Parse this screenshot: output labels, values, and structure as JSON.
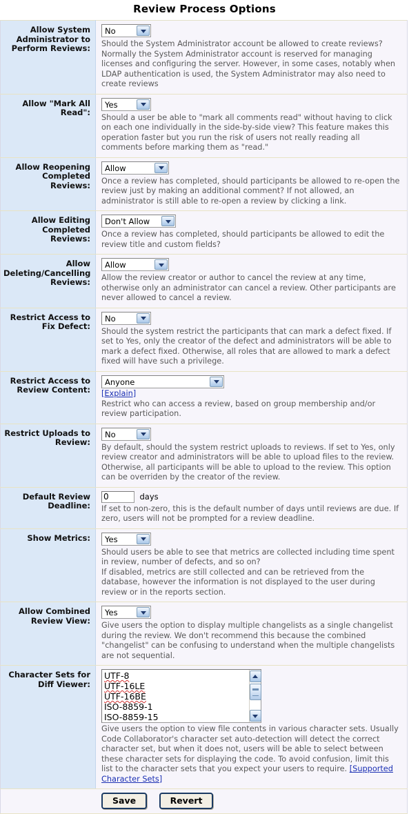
{
  "header": {
    "title": "Review Process Options"
  },
  "options": [
    {
      "label": "Allow System Administrator to Perform Reviews:",
      "control": "select",
      "value": "No",
      "width_class": "w-sel-narrow",
      "desc": [
        "Should the System Administrator account be allowed to create reviews? Normally the System Administrator account is reserved for managing licenses and configuring the server. However, in some cases, notably when LDAP authentication is used, the System Administrator may also need to create reviews"
      ]
    },
    {
      "label": "Allow \"Mark All Read\":",
      "control": "select",
      "value": "Yes",
      "width_class": "w-sel-narrow",
      "desc": [
        "Should a user be able to \"mark all comments read\" without having to click on each one individually in the side-by-side view? This feature makes this operation faster but you run the risk of users not really reading all comments before marking them as \"read.\""
      ]
    },
    {
      "label": "Allow Reopening Completed Reviews:",
      "control": "select",
      "value": "Allow",
      "width_class": "w-sel-allow",
      "desc": [
        "Once a review has completed, should participants be allowed to re-open the review just by making an additional comment? If not allowed, an administrator is still able to re-open a review by clicking a link."
      ]
    },
    {
      "label": "Allow Editing Completed Reviews:",
      "control": "select",
      "value": "Don't Allow",
      "width_class": "w-sel-dontallow",
      "desc": [
        "Once a review has completed, should participants be allowed to edit the review title and custom fields?"
      ]
    },
    {
      "label": "Allow Deleting/Cancelling Reviews:",
      "control": "select",
      "value": "Allow",
      "width_class": "w-sel-allow",
      "desc": [
        "Allow the review creator or author to cancel the review at any time, otherwise only an administrator can cancel a review. Other participants are never allowed to cancel a review."
      ]
    },
    {
      "label": "Restrict Access to Fix Defect:",
      "control": "select",
      "value": "No",
      "width_class": "w-sel-narrow",
      "desc": [
        "Should the system restrict the participants that can mark a defect fixed. If set to Yes, only the creator of the defect and administrators will be able to mark a defect fixed. Otherwise, all roles that are allowed to mark a defect fixed will have such a privilege."
      ]
    },
    {
      "label": "Restrict Access to Review Content:",
      "control": "select",
      "value": "Anyone",
      "width_class": "w-sel-wide",
      "link": "[Explain]",
      "desc": [
        "Restrict who can access a review, based on group membership and/or review participation."
      ]
    },
    {
      "label": "Restrict Uploads to Review:",
      "control": "select",
      "value": "No",
      "width_class": "w-sel-narrow",
      "desc": [
        "By default, should the system restrict uploads to reviews. If set to Yes, only review creator and administrators will be able to upload files to the review. Otherwise, all participants will be able to upload to the review. This option can be overriden by the creator of the review."
      ]
    },
    {
      "label": "Default Review Deadline:",
      "control": "text",
      "value": "0",
      "unit": "days",
      "desc": [
        "If set to non-zero, this is the default number of days until reviews are due. If zero, users will not be prompted for a review deadline."
      ]
    },
    {
      "label": "Show Metrics:",
      "control": "select",
      "value": "Yes",
      "width_class": "w-sel-narrow",
      "desc": [
        "Should users be able to see that metrics are collected including time spent in review, number of defects, and so on?",
        "If disabled, metrics are still collected and can be retrieved from the database, however the information is not displayed to the user during review or in the reports section."
      ]
    },
    {
      "label": "Allow Combined Review View:",
      "control": "select",
      "value": "Yes",
      "width_class": "w-sel-narrow",
      "desc": [
        "Give users the option to display multiple changelists as a single changelist during the review. We don't recommend this because the combined \"changelist\" can be confusing to understand when the multiple changelists are not sequential."
      ]
    },
    {
      "label": "Character Sets for Diff Viewer:",
      "control": "listbox",
      "items": [
        "UTF-8",
        "UTF-16LE",
        "UTF-16BE",
        "ISO-8859-1",
        "ISO-8859-15"
      ],
      "desc_prefix": "Give users the option to view file contents in various character sets. Usually Code Collaborator's character set auto-detection will detect the correct character set, but when it does not, users will be able to select between these character sets for displaying the code. To avoid confusion, limit this list to the character sets that you expect your users to require. ",
      "link": "[Supported Character Sets]"
    }
  ],
  "actions": {
    "save_label": "Save",
    "revert_label": "Revert"
  },
  "colors": {
    "label_background": "#dbe8f7",
    "field_background": "#f7f5fb",
    "row_divider": "#e8e3c4",
    "link": "#1a2fb3",
    "button_border": "#1b3a63"
  }
}
